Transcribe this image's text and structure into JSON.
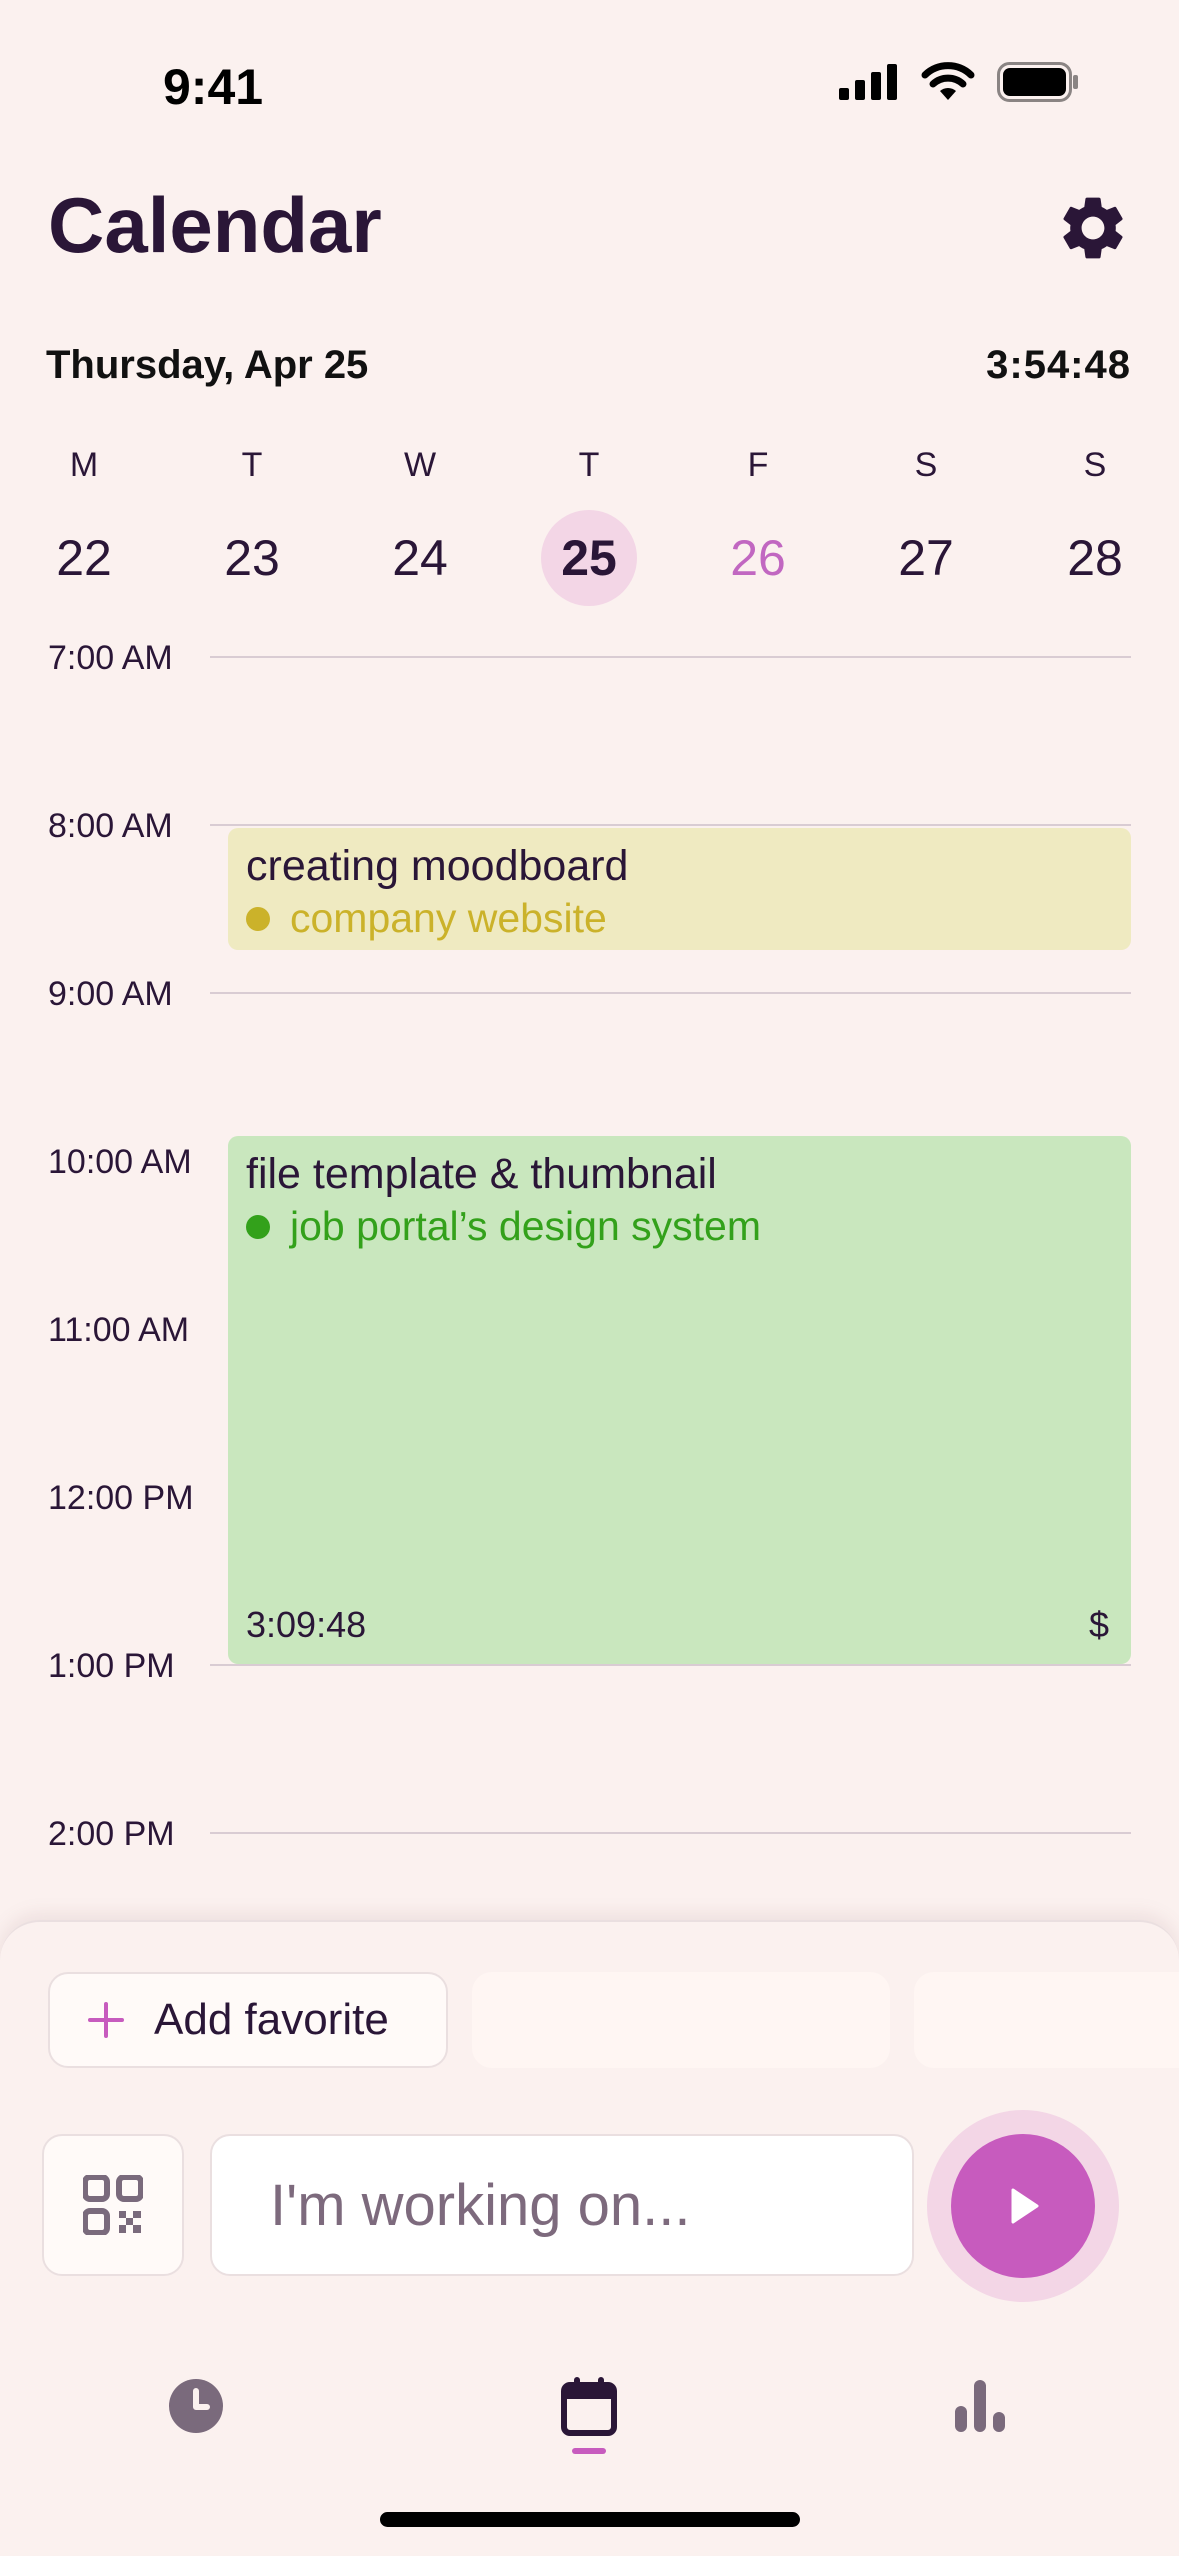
{
  "status_bar": {
    "time": "9:41"
  },
  "header": {
    "title": "Calendar",
    "settings_icon": "gear-icon"
  },
  "date_row": {
    "date": "Thursday, Apr 25",
    "timer": "3:54:48"
  },
  "week": {
    "days": [
      {
        "letter": "M",
        "num": "22"
      },
      {
        "letter": "T",
        "num": "23"
      },
      {
        "letter": "W",
        "num": "24"
      },
      {
        "letter": "T",
        "num": "25",
        "selected": true
      },
      {
        "letter": "F",
        "num": "26",
        "accent": true
      },
      {
        "letter": "S",
        "num": "27"
      },
      {
        "letter": "S",
        "num": "28"
      }
    ]
  },
  "timeline": {
    "hours": [
      "7:00 AM",
      "8:00 AM",
      "9:00 AM",
      "10:00 AM",
      "11:00 AM",
      "12:00 PM",
      "1:00 PM",
      "2:00 PM"
    ]
  },
  "events": [
    {
      "title": "creating moodboard",
      "project": "company website",
      "bg": "#efeac1",
      "accent": "#cbb22a"
    },
    {
      "title": "file template & thumbnail",
      "project": "job portal’s design system",
      "bg": "#c9e7be",
      "accent": "#33a11b",
      "duration": "3:09:48",
      "billing_symbol": "$"
    }
  ],
  "favorites": {
    "add_label": "Add favorite"
  },
  "composer": {
    "placeholder": "I'm working on...",
    "qr_icon": "qr-code-icon",
    "play_icon": "play-icon"
  },
  "tabs": [
    {
      "name": "timer",
      "icon": "clock-icon"
    },
    {
      "name": "calendar",
      "icon": "calendar-icon",
      "active": true
    },
    {
      "name": "reports",
      "icon": "bar-chart-icon"
    }
  ],
  "colors": {
    "background": "#fbf1ef",
    "accent": "#c75bbe",
    "selected_day": "#f3d6e6",
    "text": "#2a1637"
  }
}
